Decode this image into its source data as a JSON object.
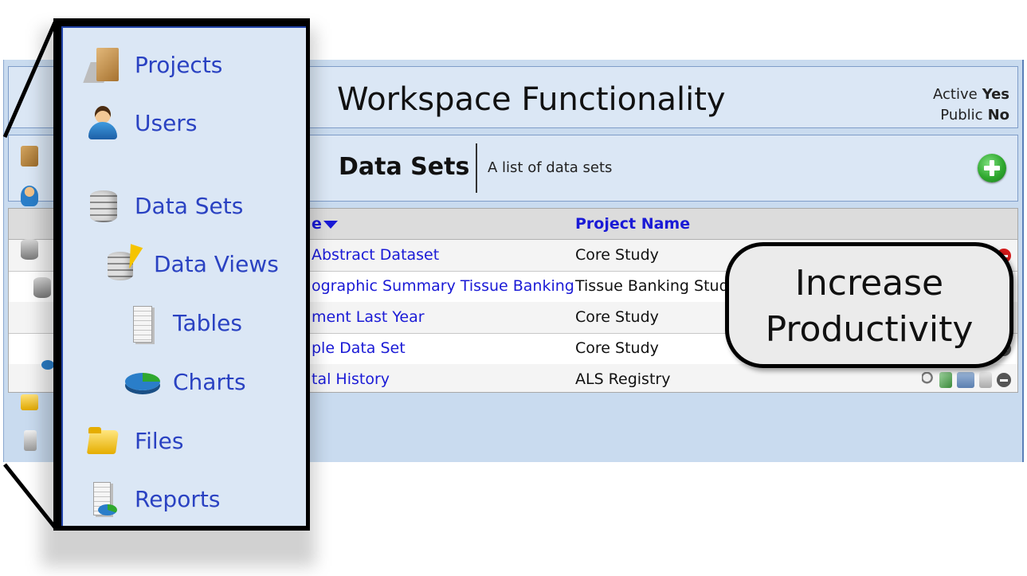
{
  "header": {
    "title": "Workspace Functionality",
    "active_label": "Active",
    "active_value": "Yes",
    "public_label": "Public",
    "public_value": "No"
  },
  "datasets": {
    "title": "Data Sets",
    "description": "A list of data sets",
    "add_icon": "add-icon"
  },
  "grid": {
    "columns": [
      "e",
      "Project Name"
    ],
    "rows": [
      {
        "name": "Abstract Dataset",
        "project": "Core Study"
      },
      {
        "name": "ographic Summary Tissue Banking",
        "project": "Tissue Banking Study"
      },
      {
        "name": "ment Last Year",
        "project": "Core Study"
      },
      {
        "name": "ple Data Set",
        "project": "Core Study"
      },
      {
        "name": "tal History",
        "project": "ALS Registry"
      }
    ]
  },
  "sidebar": {
    "items": [
      {
        "label": "Projects",
        "icon": "project-icon"
      },
      {
        "label": "Users",
        "icon": "user-icon"
      },
      {
        "label": "Data Sets",
        "icon": "database-icon"
      },
      {
        "label": "Data Views",
        "icon": "database-view-icon"
      },
      {
        "label": "Tables",
        "icon": "table-icon"
      },
      {
        "label": "Charts",
        "icon": "chart-icon"
      },
      {
        "label": "Files",
        "icon": "folder-icon"
      },
      {
        "label": "Reports",
        "icon": "report-icon"
      }
    ]
  },
  "callout": {
    "line1": "Increase",
    "line2": "Productivity"
  }
}
